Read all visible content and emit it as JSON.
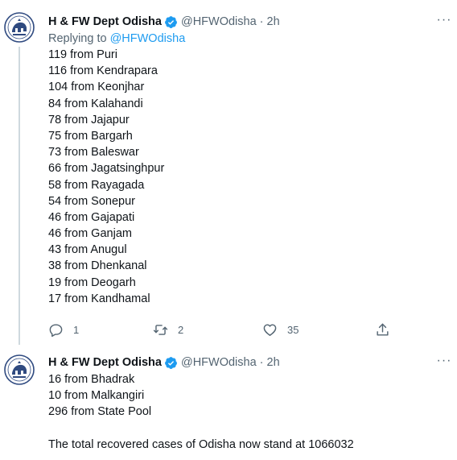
{
  "tweets": [
    {
      "author_name": "H & FW Dept Odisha",
      "handle": "@HFWOdisha",
      "separator": "·",
      "time": "2h",
      "replying_prefix": "Replying to",
      "replying_handle": "@HFWOdisha",
      "lines": [
        "119 from Puri",
        "116 from Kendrapara",
        "104 from Keonjhar",
        "84 from Kalahandi",
        "78 from Jajapur",
        "75 from Bargarh",
        "73 from Baleswar",
        "66 from Jagatsinghpur",
        "58 from Rayagada",
        "54 from Sonepur",
        "46 from Gajapati",
        "46 from Ganjam",
        "43 from Anugul",
        "38 from Dhenkanal",
        "19 from Deogarh",
        "17 from Kandhamal"
      ],
      "reply_count": "1",
      "retweet_count": "2",
      "like_count": "35",
      "more_label": "···"
    },
    {
      "author_name": "H & FW Dept Odisha",
      "handle": "@HFWOdisha",
      "separator": "·",
      "time": "2h",
      "lines": [
        "16 from Bhadrak",
        "10 from Malkangiri",
        "296 from State Pool"
      ],
      "closing_line": "The total recovered cases of Odisha now stand at 1066032",
      "more_label": "···"
    }
  ],
  "icons": {
    "avatar": "odisha-emblem-icon",
    "verified": "verified-badge-icon",
    "reply": "reply-icon",
    "retweet": "retweet-icon",
    "like": "like-icon",
    "share": "share-icon"
  },
  "colors": {
    "text": "#0f1419",
    "muted": "#536471",
    "accent": "#1d9bf0",
    "thread_line": "#cfd9de"
  }
}
